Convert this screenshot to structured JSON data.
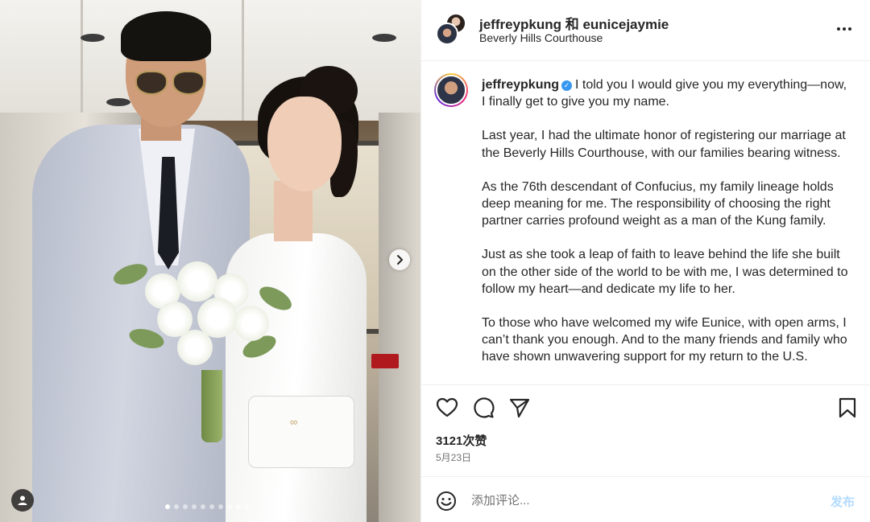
{
  "post": {
    "authors": "jeffreypkung 和 eunicejaymie",
    "location": "Beverly Hills Courthouse",
    "more_icon": "more-horizontal-icon"
  },
  "photo": {
    "carousel_dots": 10,
    "active_dot": 0,
    "next_icon": "chevron-right-icon",
    "tag_icon": "user-tag-icon"
  },
  "caption": {
    "username": "jeffreypkung",
    "verified": true,
    "paragraphs": [
      "I told you I would give you my everything—now, I finally get to give you my name.",
      "Last year, I had the ultimate honor of registering our marriage at the Beverly Hills Courthouse, with our families bearing witness.",
      "As the 76th descendant of Confucius, my family lineage holds deep meaning for me. The responsibility of choosing the right partner carries profound weight as a man of the Kung family.",
      "Just as she took a leap of faith to leave behind the life she built on the other side of the world to be with me, I was determined to follow my heart—and dedicate my life to her.",
      "To those who have welcomed my wife Eunice, with open arms, I can’t thank you enough. And to the many friends and family who have shown unwavering support for my return to the U.S."
    ]
  },
  "actions": {
    "icons": [
      "heart-icon",
      "comment-icon",
      "share-icon",
      "bookmark-icon"
    ],
    "likes": "3121次赞",
    "date": "5月23日"
  },
  "comment": {
    "placeholder": "添加评论...",
    "post_label": "发布",
    "post_color": "#b3dbff",
    "emoji_icon": "emoji-icon"
  },
  "colors": {
    "text": "#262626",
    "secondary": "#737373",
    "verified": "#3897f0",
    "divider": "#efefef"
  }
}
